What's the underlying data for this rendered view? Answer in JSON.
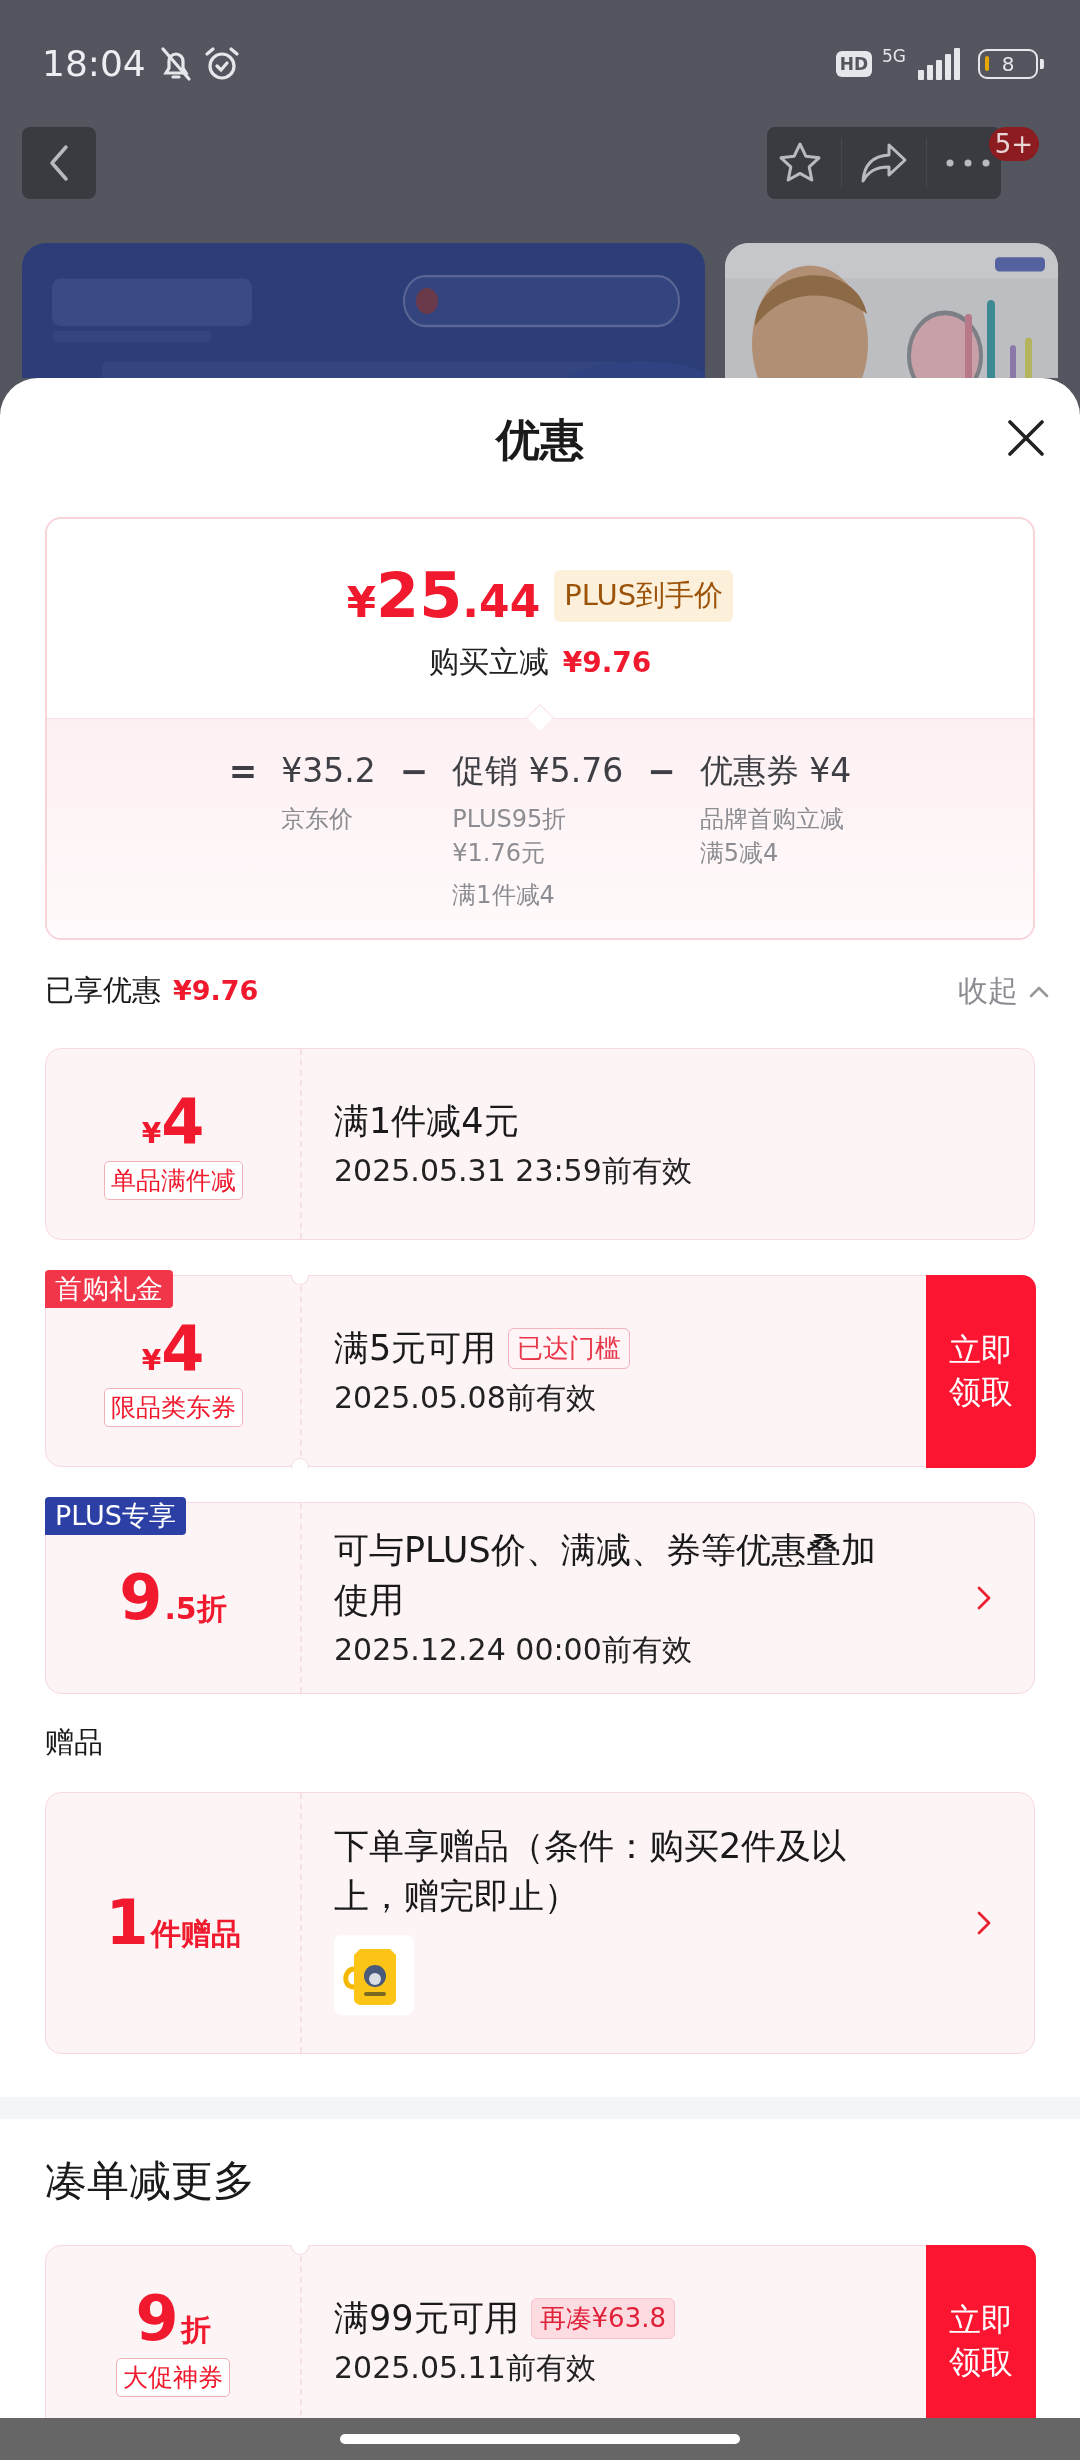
{
  "status_bar": {
    "time": "18:04",
    "hd": "HD",
    "network": "5G",
    "battery": "8"
  },
  "nav": {
    "badge": "5+"
  },
  "sheet": {
    "title": "优惠"
  },
  "price_card": {
    "currency": "¥",
    "price_int": "25",
    "price_dec": ".44",
    "price_badge": "PLUS到手价",
    "saving_label": "购买立减",
    "saving": "¥9.76",
    "breakdown": [
      {
        "kind": "operator",
        "text": "="
      },
      {
        "kind": "term",
        "amount": "¥35.2",
        "notes": [
          [
            "京东价"
          ]
        ]
      },
      {
        "kind": "operator",
        "text": "−"
      },
      {
        "kind": "term",
        "amount": "促销 ¥5.76",
        "notes": [
          [
            "PLUS95折",
            "¥1.76元"
          ],
          [
            "满1件减4"
          ]
        ]
      },
      {
        "kind": "operator",
        "text": "−"
      },
      {
        "kind": "term",
        "amount": "优惠券 ¥4",
        "notes": [
          [
            "品牌首购立减",
            "满5减4"
          ]
        ]
      }
    ]
  },
  "summary": {
    "label": "已享优惠",
    "amount": "¥9.76",
    "toggle": "收起",
    "expanded": true
  },
  "coupons": [
    {
      "kind": "promo",
      "amount": {
        "prefix": "¥",
        "main": "4"
      },
      "label": "单品满件减",
      "title": "满1件减4元",
      "validity": "2025.05.31 23:59前有效"
    },
    {
      "kind": "coupon",
      "corner_tag": {
        "kind": "red",
        "text": "首购礼金"
      },
      "amount": {
        "prefix": "¥",
        "main": "4"
      },
      "label": "限品类东券",
      "title": "满5元可用",
      "badge": {
        "kind": "outline",
        "text": "已达门槛"
      },
      "validity": "2025.05.08前有效",
      "action": {
        "kind": "button",
        "label": "立即领取"
      }
    },
    {
      "kind": "promo",
      "corner_tag": {
        "kind": "plus",
        "text": "PLUS专享"
      },
      "amount": {
        "main": "9",
        "suffix": ".5折"
      },
      "title": "可与PLUS价、满减、券等优惠叠加使用",
      "validity": "2025.12.24 00:00前有效",
      "action": {
        "kind": "arrow"
      }
    }
  ],
  "gift_section": {
    "title": "赠品",
    "gift": {
      "amount": {
        "main": "1",
        "suffix": "件赠品"
      },
      "title": "下单享赠品（条件：购买2件及以上，赠完即止）",
      "action": {
        "kind": "arrow"
      }
    }
  },
  "more_section": {
    "title": "凑单减更多",
    "coupons": [
      {
        "kind": "coupon",
        "amount": {
          "main": "9",
          "suffix": "折"
        },
        "label": "大促神券",
        "title": "满99元可用",
        "badge": {
          "kind": "filled",
          "text": "再凑¥63.8"
        },
        "validity": "2025.05.11前有效",
        "action": {
          "kind": "button",
          "label": "立即领取"
        }
      }
    ]
  }
}
